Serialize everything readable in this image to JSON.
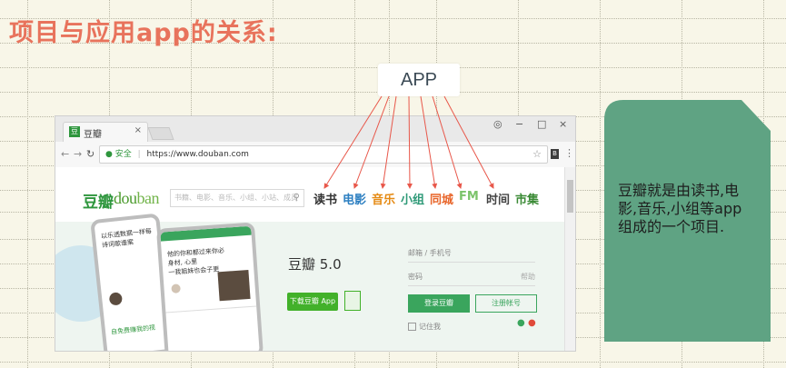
{
  "slide": {
    "title": "项目与应用app的关系:",
    "app_label": "APP",
    "callout_text": "豆瓣就是由读书,电影,音乐,小组等app组成的一个项目."
  },
  "browser": {
    "tab_title": "豆瓣",
    "tab_close": "×",
    "window_controls": [
      "−",
      "□",
      "×"
    ],
    "secure_label": "安全",
    "url": "https://www.douban.com",
    "ext_label": "B"
  },
  "site": {
    "logo_cn": "豆瓣",
    "logo_en_a": "dou",
    "logo_en_b": "ban",
    "search_placeholder": "书籍、电影、音乐、小组、小站、成员",
    "nav": [
      {
        "label": "读书",
        "color": "#333333"
      },
      {
        "label": "电影",
        "color": "#2d7fc1"
      },
      {
        "label": "音乐",
        "color": "#e58a13"
      },
      {
        "label": "小组",
        "color": "#2f9a78"
      },
      {
        "label": "同城",
        "color": "#e8652a"
      },
      {
        "label": "FM",
        "color": "#7bc36a"
      },
      {
        "label": "时间",
        "color": "#444444"
      },
      {
        "label": "市集",
        "color": "#3a8a35"
      }
    ],
    "app_name": "豆瓣 5.0",
    "download_label": "下载豆瓣 App",
    "login": {
      "phone_placeholder": "邮箱 / 手机号",
      "password_placeholder": "密码",
      "help_label": "帮助",
      "login_label": "登录豆瓣",
      "register_label": "注册帐号",
      "remember_label": "记住我"
    },
    "phone_back_lines": [
      "以乐透数据一样每",
      "诗词歌谱案"
    ],
    "phone_front_lines": [
      "他的你和都过来你必",
      "身材, 心里",
      "一我姐妹也会子更"
    ],
    "phone_bottom_text": "自免费赚我的视"
  },
  "colors": {
    "title": "#e8735c",
    "callout_fill": "#5fa383",
    "arrow": "#e8574a",
    "douban_green": "#2e963d"
  }
}
